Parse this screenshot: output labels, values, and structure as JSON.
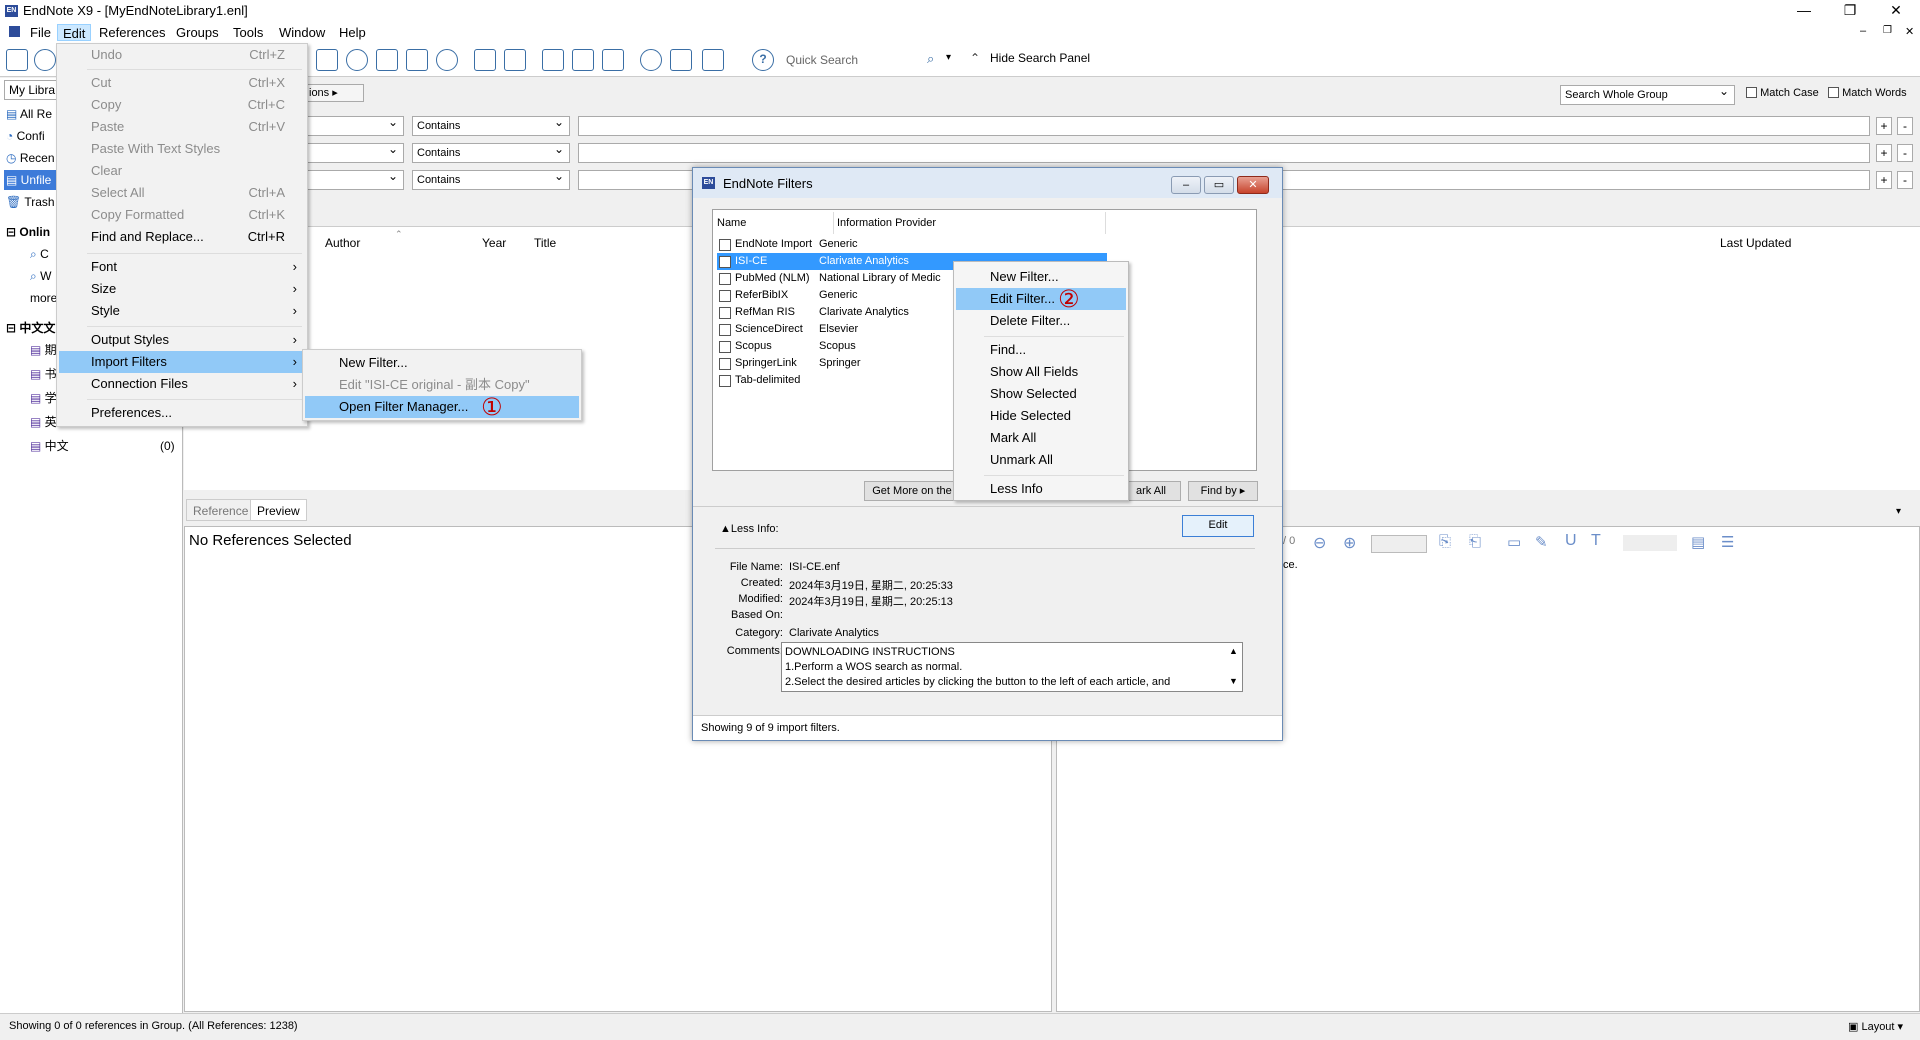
{
  "window": {
    "title": "EndNote X9 - [MyEndNoteLibrary1.enl]",
    "app_icon": "EN"
  },
  "menubar": [
    "File",
    "Edit",
    "References",
    "Groups",
    "Tools",
    "Window",
    "Help"
  ],
  "toolbar": {
    "quick_search_placeholder": "Quick Search",
    "hide_search_panel": "Hide Search Panel"
  },
  "left_panel": {
    "library_dropdown": "My Libra",
    "items": [
      {
        "label": "All Re",
        "selected": false
      },
      {
        "label": "Confi",
        "selected": false
      },
      {
        "label": "Recen",
        "selected": false
      },
      {
        "label": "Unfile",
        "selected": true
      },
      {
        "label": "Trash",
        "selected": false
      }
    ],
    "online_header": "Onlin",
    "online_items": [
      "C",
      "W"
    ],
    "more": "more",
    "group_header": "中文文",
    "group_items": [
      {
        "label": "期",
        "count": ""
      },
      {
        "label": "书",
        "count": ""
      },
      {
        "label": "学",
        "count": ""
      },
      {
        "label": "英",
        "count": ""
      },
      {
        "label": "中文",
        "count": "(0)"
      }
    ]
  },
  "search_panel": {
    "options_button": "ions",
    "search_scope": "Search Whole Group",
    "match_case": "Match Case",
    "match_words": "Match Words",
    "rows": [
      {
        "operator": "Contains"
      },
      {
        "operator": "Contains"
      },
      {
        "operator": "Contains"
      }
    ],
    "plus": "+",
    "minus": "-"
  },
  "reference_list": {
    "columns": [
      "Author",
      "Year",
      "Title",
      "Last Updated"
    ]
  },
  "bottom": {
    "tabs": [
      "Reference",
      "Preview"
    ],
    "no_refs": "No References Selected",
    "right_text": "ce.",
    "page_counter": "/ 0"
  },
  "statusbar": {
    "text": "Showing 0 of 0 references in Group. (All References: 1238)",
    "layout": "Layout"
  },
  "edit_menu": {
    "items": [
      {
        "label": "Undo",
        "shortcut": "Ctrl+Z",
        "disabled": true
      },
      {
        "label": "Cut",
        "shortcut": "Ctrl+X",
        "disabled": true
      },
      {
        "label": "Copy",
        "shortcut": "Ctrl+C",
        "disabled": true
      },
      {
        "label": "Paste",
        "shortcut": "Ctrl+V",
        "disabled": true
      },
      {
        "label": "Paste With Text Styles",
        "shortcut": "",
        "disabled": true
      },
      {
        "label": "Clear",
        "shortcut": "",
        "disabled": true
      },
      {
        "label": "Select All",
        "shortcut": "Ctrl+A",
        "disabled": true
      },
      {
        "label": "Copy Formatted",
        "shortcut": "Ctrl+K",
        "disabled": true
      },
      {
        "label": "Find and Replace...",
        "shortcut": "Ctrl+R",
        "disabled": false
      },
      {
        "label": "Font",
        "shortcut": "",
        "disabled": false
      },
      {
        "label": "Size",
        "shortcut": "",
        "disabled": false
      },
      {
        "label": "Style",
        "shortcut": "",
        "disabled": false
      },
      {
        "label": "Output Styles",
        "shortcut": "",
        "disabled": false
      },
      {
        "label": "Import Filters",
        "shortcut": "",
        "disabled": false
      },
      {
        "label": "Connection Files",
        "shortcut": "",
        "disabled": false
      },
      {
        "label": "Preferences...",
        "shortcut": "",
        "disabled": false
      }
    ]
  },
  "import_submenu": {
    "items": [
      "New Filter...",
      "Edit \"ISI-CE original - 副本 Copy\"",
      "Open Filter Manager..."
    ],
    "marker": "①"
  },
  "dialog": {
    "title": "EndNote Filters",
    "columns": [
      "Name",
      "Information Provider"
    ],
    "filters": [
      {
        "name": "EndNote Import",
        "provider": "Generic"
      },
      {
        "name": "ISI-CE",
        "provider": "Clarivate Analytics"
      },
      {
        "name": "PubMed (NLM)",
        "provider": "National Library of Medic"
      },
      {
        "name": "ReferBibIX",
        "provider": "Generic"
      },
      {
        "name": "RefMan RIS",
        "provider": "Clarivate Analytics"
      },
      {
        "name": "ScienceDirect",
        "provider": "Elsevier"
      },
      {
        "name": "Scopus",
        "provider": "Scopus"
      },
      {
        "name": "SpringerLink",
        "provider": "Springer"
      },
      {
        "name": "Tab-delimited",
        "provider": ""
      }
    ],
    "buttons": {
      "get_more": "Get More on the",
      "mark_all": "ark All",
      "find_by": "Find by",
      "edit": "Edit"
    },
    "less_info": "Less Info:",
    "info": {
      "file_name_label": "File Name:",
      "file_name": "ISI-CE.enf",
      "created_label": "Created:",
      "created": "2024年3月19日, 星期二, 20:25:33",
      "modified_label": "Modified:",
      "modified": "2024年3月19日, 星期二, 20:25:13",
      "based_on_label": "Based On:",
      "category_label": "Category:",
      "category": "Clarivate Analytics",
      "comments_label": "Comments:",
      "comments": [
        "DOWNLOADING INSTRUCTIONS",
        "1.Perform a WOS search as normal.",
        "2.Select the desired articles by clicking the button to the left of each article, and"
      ]
    },
    "status": "Showing 9 of 9 import filters."
  },
  "context_menu": {
    "items": [
      "New Filter...",
      "Edit Filter...",
      "Delete Filter...",
      "Find...",
      "Show All Fields",
      "Show Selected",
      "Hide Selected",
      "Mark All",
      "Unmark All",
      "Less Info"
    ],
    "marker": "②"
  }
}
